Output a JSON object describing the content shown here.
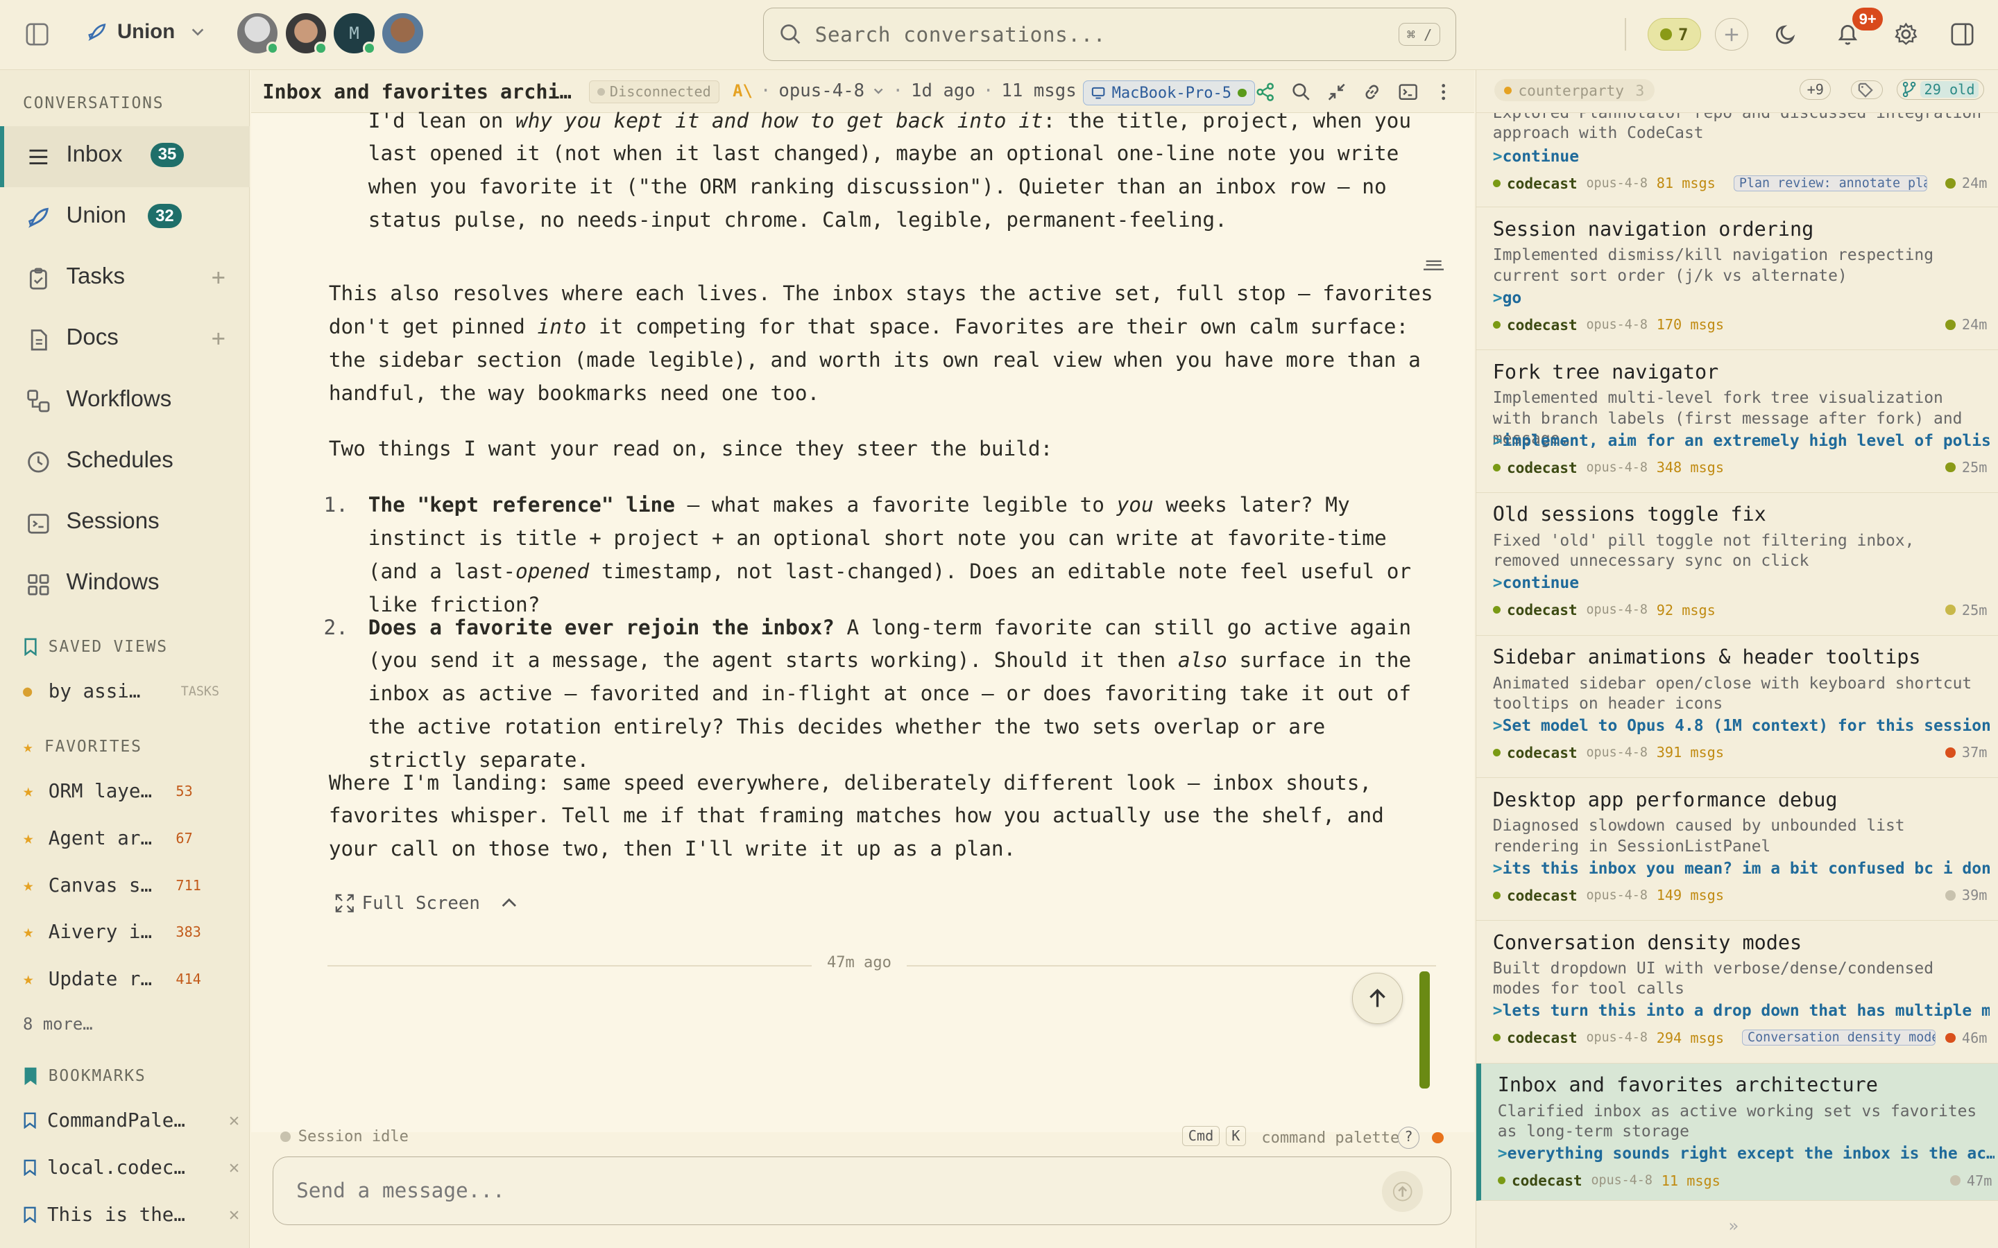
{
  "topbar": {
    "workspace": "Union",
    "avatar_initial": "M",
    "search_placeholder": "Search conversations...",
    "search_shortcut": "⌘ /",
    "active_count": "7",
    "notifications_badge": "9+"
  },
  "sidebar": {
    "conversations_heading": "CONVERSATIONS",
    "nav": [
      {
        "label": "Inbox",
        "count": "35"
      },
      {
        "label": "Union",
        "count": "32"
      },
      {
        "label": "Tasks"
      },
      {
        "label": "Docs"
      },
      {
        "label": "Workflows"
      },
      {
        "label": "Schedules"
      },
      {
        "label": "Sessions"
      },
      {
        "label": "Windows"
      }
    ],
    "saved_views_heading": "SAVED VIEWS",
    "saved_view": {
      "label": "by assi…",
      "tag": "TASKS"
    },
    "favorites_heading": "FAVORITES",
    "favorites": [
      {
        "label": "ORM laye…",
        "count": "53"
      },
      {
        "label": "Agent ar…",
        "count": "67"
      },
      {
        "label": "Canvas s…",
        "count": "711"
      },
      {
        "label": "Aivery i…",
        "count": "383"
      },
      {
        "label": "Update r…",
        "count": "414"
      }
    ],
    "favorites_more": "8 more…",
    "bookmarks_heading": "BOOKMARKS",
    "bookmarks": [
      {
        "label": "CommandPale…"
      },
      {
        "label": "local.codec…"
      },
      {
        "label": "This is the…"
      }
    ]
  },
  "conversation": {
    "title": "Inbox and favorites archi…",
    "connection": "Disconnected",
    "model": "opus-4-8",
    "age": "1d ago",
    "msgs": "11 msgs",
    "machine": "MacBook-Pro-5",
    "p1_a": "I'd lean on ",
    "p1_em": "why you kept it and how to get back into it",
    "p1_b": ": the title, project, when you last opened it (not when it last changed), maybe an optional one-line note you write when you favorite it (\"the ORM ranking discussion\"). Quieter than an inbox row — no status pulse, no needs-input chrome. Calm, legible, permanent-feeling.",
    "p2_a": "This also resolves where each lives. The inbox stays the active set, full stop — favorites don't get pinned ",
    "p2_em": "into",
    "p2_b": " it competing for that space. Favorites are their own calm surface: the sidebar section (made legible), and worth its own real view when you have more than a handful, the way bookmarks need one too.",
    "p3": "Two things I want your read on, since they steer the build:",
    "li1_num": "1.",
    "li1_bold": "The \"kept reference\" line",
    "li1_a": " — what makes a favorite legible to ",
    "li1_em": "you",
    "li1_b": " weeks later? My instinct is title + project + an optional short note you can write at favorite-time (and a last-",
    "li1_em2": "opened",
    "li1_c": " timestamp, not last-changed). Does an editable note feel useful or like friction?",
    "li2_num": "2.",
    "li2_bold": "Does a favorite ever rejoin the inbox?",
    "li2_a": " A long-term favorite can still go active again (you send it a message, the agent starts working). Should it then ",
    "li2_em": "also",
    "li2_b": " surface in the inbox as active — favorited and in-flight at once — or does favoriting take it out of the active rotation entirely? This decides whether the two sets overlap or are strictly separate.",
    "p4": "Where I'm landing: same speed everywhere, deliberately different look — inbox shouts, favorites whisper. Tell me if that framing matches how you actually use the shelf, and your call on those two, then I'll write it up as a plan.",
    "full_screen": "Full Screen",
    "timestamp": "47m ago",
    "session_status": "Session idle",
    "kbd_cmd": "Cmd",
    "kbd_k": "K",
    "command_palette": "command palette",
    "help": "?",
    "message_placeholder": "Send a message..."
  },
  "right_panel": {
    "filter_label": "counterparty",
    "filter_count": "3",
    "more_count": "+9",
    "old_count": "29",
    "old_label": "old",
    "top_summary": "Explored Plannotator repo and discussed integration approach with CodeCast",
    "top_prompt": "continue",
    "top_meta": {
      "project": "codecast",
      "model": "opus-4-8",
      "msgs": "81 msgs",
      "tag": "Plan review: annotate pla",
      "age": "24m",
      "dot": "#8a9a17"
    },
    "cards": [
      {
        "title": "Session navigation ordering",
        "summary": "Implemented dismiss/kill navigation respecting current sort order (j/k vs alternate)",
        "prompt": "go",
        "project": "codecast",
        "model": "opus-4-8",
        "msgs": "170 msgs",
        "tag": "",
        "age": "24m",
        "dot": "#8a9a17"
      },
      {
        "title": "Fork tree navigator",
        "summary": "Implemented multi-level fork tree visualization with branch labels (first message after fork) and message…",
        "prompt": "implement, aim for an extremely high level of polish",
        "project": "codecast",
        "model": "opus-4-8",
        "msgs": "348 msgs",
        "tag": "",
        "age": "25m",
        "dot": "#8a9a17"
      },
      {
        "title": "Old sessions toggle fix",
        "summary": "Fixed 'old' pill toggle not filtering inbox, removed unnecessary sync on click",
        "prompt": "continue",
        "project": "codecast",
        "model": "opus-4-8",
        "msgs": "92 msgs",
        "tag": "",
        "age": "25m",
        "dot": "#c8b84a"
      },
      {
        "title": "Sidebar animations & header tooltips",
        "summary": "Animated sidebar open/close with keyboard shortcut tooltips on header icons",
        "prompt": "Set model to Opus 4.8 (1M context) for this session…",
        "project": "codecast",
        "model": "opus-4-8",
        "msgs": "391 msgs",
        "tag": "",
        "age": "37m",
        "dot": "#d9501c"
      },
      {
        "title": "Desktop app performance debug",
        "summary": "Diagnosed slowdown caused by unbounded list rendering in SessionListPanel",
        "prompt": "its this inbox you mean? im a bit confused bc i don…",
        "project": "codecast",
        "model": "opus-4-8",
        "msgs": "149 msgs",
        "tag": "",
        "age": "39m",
        "dot": "#c8c2ae"
      },
      {
        "title": "Conversation density modes",
        "summary": "Built dropdown UI with verbose/dense/condensed modes for tool calls",
        "prompt": "lets turn this into a drop down that has multiple m…",
        "project": "codecast",
        "model": "opus-4-8",
        "msgs": "294 msgs",
        "tag": "Conversation density mode",
        "age": "46m",
        "dot": "#d9501c"
      },
      {
        "title": "Inbox and favorites architecture",
        "summary": "Clarified inbox as active working set vs favorites as long-term storage",
        "prompt": "everything sounds right except the inbox is the ac…",
        "project": "codecast",
        "model": "opus-4-8",
        "msgs": "11 msgs",
        "tag": "",
        "age": "47m",
        "dot": "#c8c2ae"
      }
    ],
    "expand_label": "»"
  }
}
